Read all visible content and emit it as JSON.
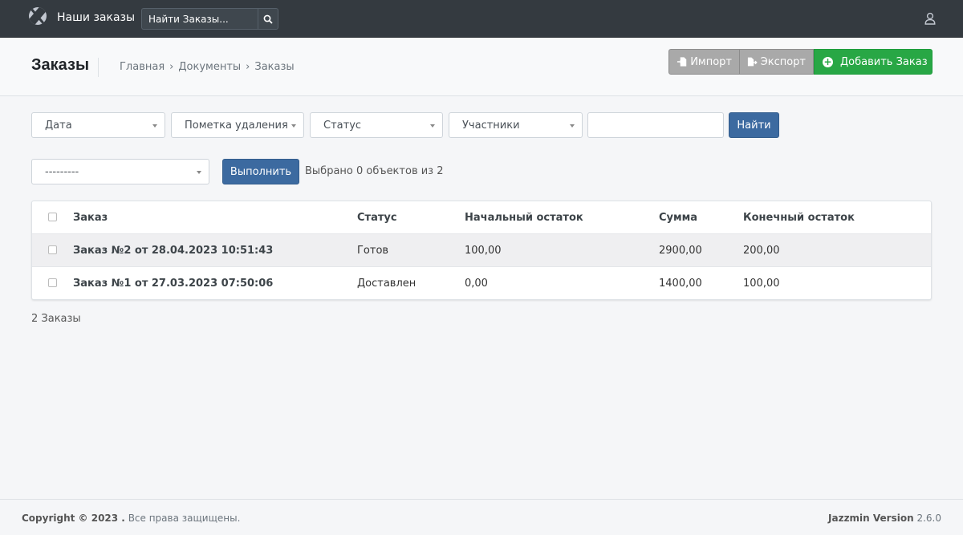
{
  "navbar": {
    "brand": "Наши заказы",
    "search_placeholder": "Найти Заказы..."
  },
  "header": {
    "title": "Заказы",
    "breadcrumb": [
      "Главная",
      "Документы",
      "Заказы"
    ],
    "import_label": "Импорт",
    "export_label": "Экспорт",
    "add_label": "Добавить Заказ"
  },
  "filters": {
    "date": "Дата",
    "deletion_mark": "Пометка удаления",
    "status": "Статус",
    "participants": "Участники",
    "search_value": "",
    "find_label": "Найти"
  },
  "actions": {
    "selected_action": "---------",
    "run_label": "Выполнить",
    "selection_info": "Выбрано 0 объектов из 2"
  },
  "table": {
    "columns": [
      "Заказ",
      "Статус",
      "Начальный остаток",
      "Сумма",
      "Конечный остаток"
    ],
    "rows": [
      {
        "order": "Заказ №2 от 28.04.2023 10:51:43",
        "status": "Готов",
        "start": "100,00",
        "sum": "2900,00",
        "end": "200,00"
      },
      {
        "order": "Заказ №1 от 27.03.2023 07:50:06",
        "status": "Доставлен",
        "start": "0,00",
        "sum": "1400,00",
        "end": "100,00"
      }
    ]
  },
  "count_text": "2 Заказы",
  "footer": {
    "copyright_bold": "Copyright © 2023 .",
    "copyright_rest": "Все права защищены.",
    "version_label": "Jazzmin Version",
    "version_number": "2.6.0"
  },
  "colors": {
    "navbar": "#343a40",
    "primary": "#3c6aa0",
    "success": "#28a745",
    "secondary": "#a9a9a9"
  },
  "icons": [
    "logo-icon",
    "search-icon",
    "user-icon",
    "import-icon",
    "export-icon",
    "plus-circle-icon",
    "caret-down-icon"
  ]
}
